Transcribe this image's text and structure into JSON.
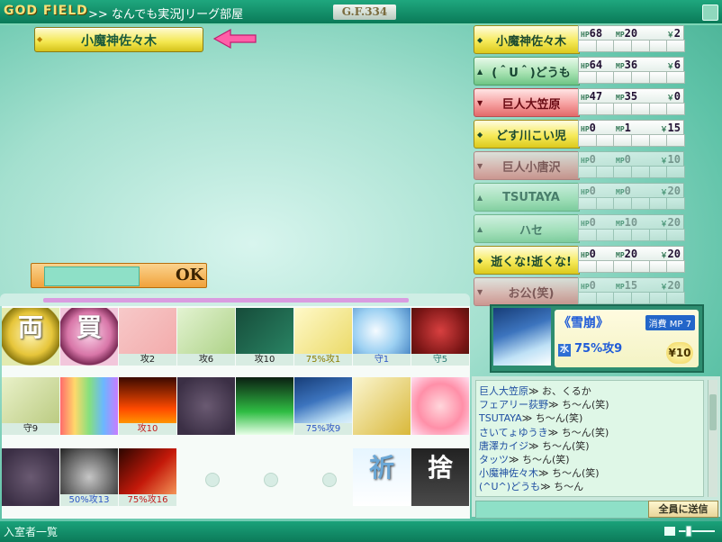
{
  "header": {
    "logo": "GOD FIELD",
    "room": ">> なんでも実況Jリーグ部屋",
    "version": "G.F.334"
  },
  "turn": {
    "player": "小魔神佐々木"
  },
  "players": [
    {
      "name": "小魔神佐々木",
      "hp": "68",
      "mp": "20",
      "gold": "2",
      "color": "yellow",
      "dim": false
    },
    {
      "name": "(＾U＾)どうも",
      "hp": "64",
      "mp": "36",
      "gold": "6",
      "color": "green",
      "dim": false
    },
    {
      "name": "巨人大笠原",
      "hp": "47",
      "mp": "35",
      "gold": "0",
      "color": "red",
      "dim": false
    },
    {
      "name": "どす川こい児",
      "hp": "0",
      "mp": "1",
      "gold": "15",
      "color": "yellow",
      "dim": false
    },
    {
      "name": "巨人小唐沢",
      "hp": "0",
      "mp": "0",
      "gold": "10",
      "color": "red",
      "dim": true
    },
    {
      "name": "TSUTAYA",
      "hp": "0",
      "mp": "0",
      "gold": "20",
      "color": "green",
      "dim": true
    },
    {
      "name": "ハセ",
      "hp": "0",
      "mp": "10",
      "gold": "20",
      "color": "green",
      "dim": true
    },
    {
      "name": "逝くな!逝くな!",
      "hp": "0",
      "mp": "20",
      "gold": "20",
      "color": "yellow",
      "dim": false
    },
    {
      "name": "お公(笑)",
      "hp": "0",
      "mp": "15",
      "gold": "20",
      "color": "red",
      "dim": true
    }
  ],
  "labels": {
    "hp": "HP",
    "mp": "MP",
    "yen": "￥"
  },
  "entry": {
    "ok": "OK"
  },
  "cards": [
    {
      "icon": "両",
      "caption": ""
    },
    {
      "icon": "買",
      "caption": ""
    },
    {
      "icon": "staff-icon",
      "caption": "攻2"
    },
    {
      "icon": "whip-icon",
      "caption": "攻6"
    },
    {
      "icon": "spear-icon",
      "caption": "攻10"
    },
    {
      "icon": "bow-icon",
      "caption": "75%攻1"
    },
    {
      "icon": "bubble-shield-icon",
      "caption": "守1"
    },
    {
      "icon": "jewel-armor-icon",
      "caption": "守5"
    },
    {
      "icon": "armor-icon",
      "caption": "守9"
    },
    {
      "icon": "rainbow-cloth-icon",
      "caption": ""
    },
    {
      "icon": "flame-icon",
      "caption": "攻10"
    },
    {
      "icon": "dark-cloud-icon",
      "caption": ""
    },
    {
      "icon": "green-spike-icon",
      "caption": ""
    },
    {
      "icon": "avalanche-icon",
      "caption": "75%攻9"
    },
    {
      "icon": "golden-item-icon",
      "caption": ""
    },
    {
      "icon": "rose-icon",
      "caption": ""
    },
    {
      "icon": "dark-cloud-icon",
      "caption": ""
    },
    {
      "icon": "gray-storm-icon",
      "caption": "50%攻13"
    },
    {
      "icon": "fire-rain-icon",
      "caption": "75%攻16"
    },
    {
      "icon": "祈",
      "caption": ""
    },
    {
      "icon": "捨",
      "caption": ""
    }
  ],
  "detail": {
    "name": "《雪崩》",
    "cost": "消費 MP  7",
    "element": "水",
    "effect": "75%攻9",
    "price": "¥10"
  },
  "chat": {
    "lines": [
      {
        "user": "巨人大笠原",
        "msg": "お、くるか"
      },
      {
        "user": "フェアリー荻野",
        "msg": "ち～ん(笑)"
      },
      {
        "user": "TSUTAYA",
        "msg": "ち～ん(笑)"
      },
      {
        "user": "さいてょゆうき",
        "msg": "ち～ん(笑)"
      },
      {
        "user": "唐澤カイジ",
        "msg": "ち～ん(笑)"
      },
      {
        "user": "タッツ",
        "msg": "ち～ん(笑)"
      },
      {
        "user": "小魔神佐々木",
        "msg": "ち～ん(笑)"
      },
      {
        "user": "(^U^)どうも",
        "msg": "ち～ん"
      }
    ],
    "sep": "≫ ",
    "send": "全員に送信"
  },
  "footer": {
    "members": "入室者一覧"
  }
}
